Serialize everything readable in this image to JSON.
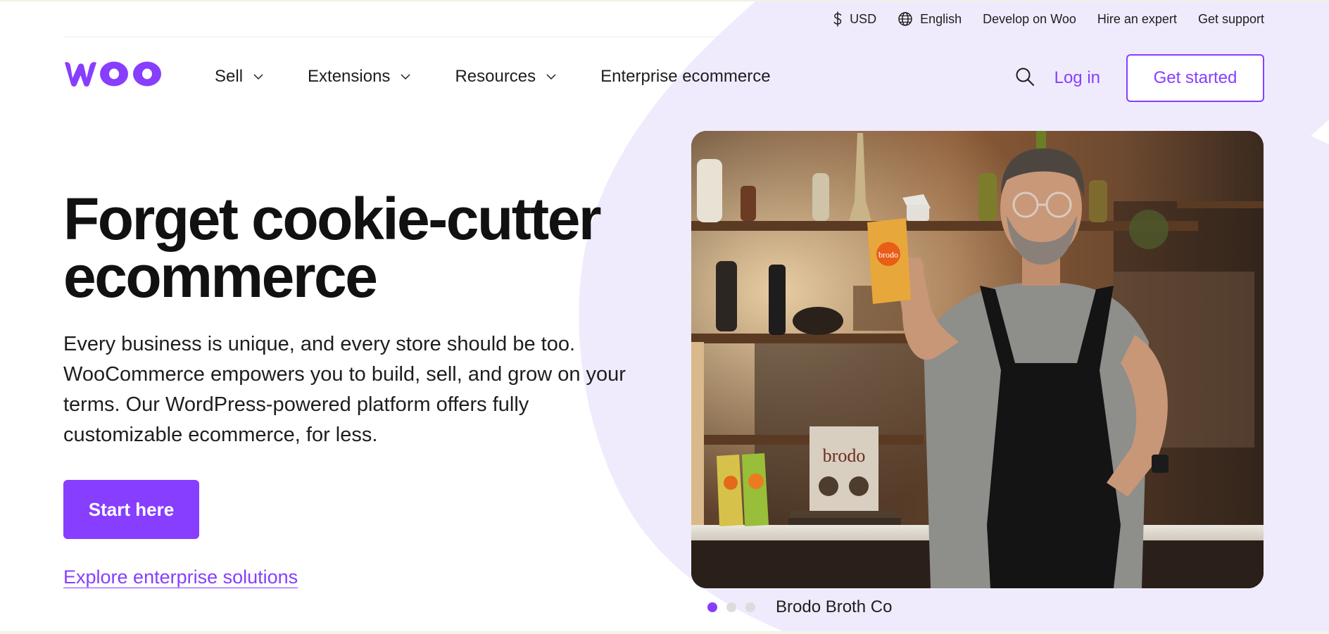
{
  "colors": {
    "accent": "#873eff",
    "blob": "#efebfd",
    "text": "#1e1e1e"
  },
  "utility_bar": {
    "currency": {
      "icon": "dollar-icon",
      "label": "USD"
    },
    "language": {
      "icon": "globe-icon",
      "label": "English"
    },
    "links": [
      "Develop on Woo",
      "Hire an expert",
      "Get support"
    ]
  },
  "nav": {
    "logo_alt": "woo",
    "items": [
      {
        "label": "Sell",
        "has_dropdown": true
      },
      {
        "label": "Extensions",
        "has_dropdown": true
      },
      {
        "label": "Resources",
        "has_dropdown": true
      },
      {
        "label": "Enterprise ecommerce",
        "has_dropdown": false
      }
    ],
    "search_icon": "search-icon",
    "login_label": "Log in",
    "cta_label": "Get started"
  },
  "hero": {
    "title": "Forget cookie-cutter ecommerce",
    "description": "Every business is unique, and every store should be too. WooCommerce empowers you to build, sell, and grow on your terms. Our WordPress-powered platform offers fully customizable ecommerce, for less.",
    "primary_cta": "Start here",
    "secondary_link": "Explore enterprise solutions"
  },
  "showcase": {
    "caption": "Brodo Broth Co",
    "active_slide": 1,
    "slides_count": 3,
    "image_packaging_text": "brodo",
    "image_book_text": "brodo"
  }
}
